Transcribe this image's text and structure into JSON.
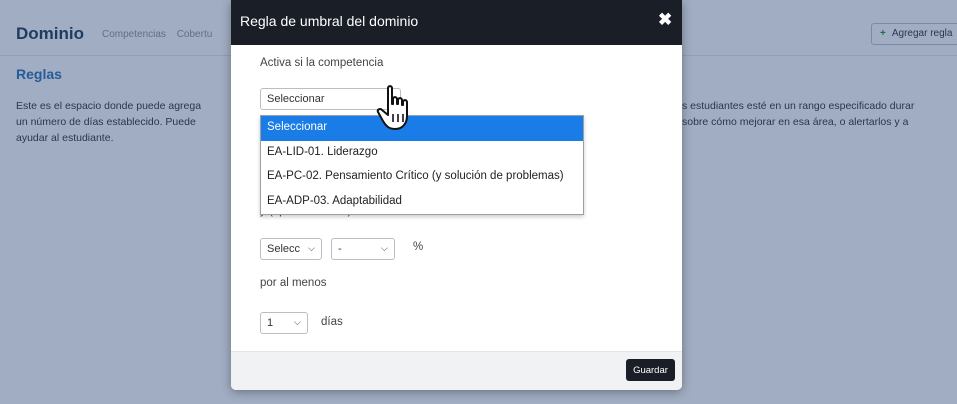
{
  "page": {
    "title": "Dominio",
    "tabs": [
      "Competencias",
      "Cobertu"
    ],
    "add_rule_label": "Agregar regla",
    "section_title": "Reglas",
    "text_left": [
      "Este es el espacio donde puede agrega",
      "un número de días establecido. Puede",
      "ayudar al estudiante."
    ],
    "text_right": [
      "s estudiantes esté en un rango especificado durar",
      "sobre cómo mejorar en esa área, o alertarlos y a",
      ""
    ]
  },
  "modal": {
    "title": "Regla de umbral del dominio",
    "close_icon": "✖",
    "label_competence": "Activa si la competencia",
    "competence_select_value": "Seleccionar",
    "dropdown_options": [
      "Seleccionar",
      "EA-LID-01. Liderazgo",
      "EA-PC-02. Pensamiento Crítico (y solución de problemas)",
      "EA-ADP-03. Adaptabilidad"
    ],
    "label_range": "y (opcionalmente)",
    "operator_select_value": "Selecc",
    "value_select_value": "-",
    "percent_label": "%",
    "label_at_least": "por al menos",
    "days_select_value": "1",
    "days_label": "días",
    "save_label": "Guardar"
  },
  "icons": {
    "plus": "plus-icon",
    "close": "close-icon",
    "chevron": "chevron-down-icon",
    "cursor": "hand-pointer-icon"
  },
  "colors": {
    "modal_header": "#1a1e27",
    "section_title": "#2a72b5",
    "selected_option": "#1a7ce6",
    "overlay": "rgba(30,60,110,0.42)"
  }
}
